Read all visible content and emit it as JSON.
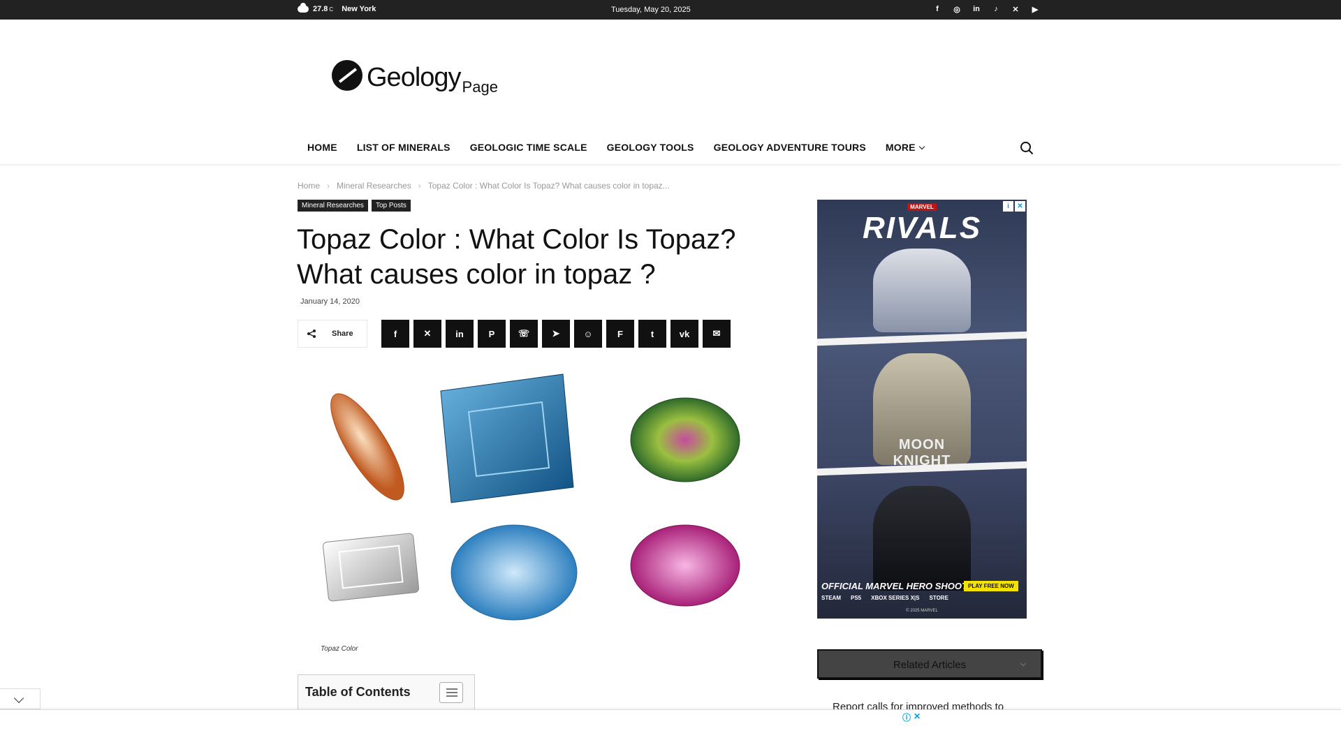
{
  "topbar": {
    "temperature": "27.8",
    "unit": "C",
    "city": "New York",
    "date": "Tuesday, May 20, 2025",
    "socials": [
      "facebook-icon",
      "instagram-icon",
      "linkedin-icon",
      "tiktok-icon",
      "x-icon",
      "youtube-icon"
    ],
    "social_glyphs": [
      "f",
      "◎",
      "in",
      "♪",
      "✕",
      "▶"
    ]
  },
  "logo": {
    "word": "Geology",
    "sub": "Page"
  },
  "nav": {
    "items": [
      "HOME",
      "LIST OF MINERALS",
      "GEOLOGIC TIME SCALE",
      "GEOLOGY TOOLS",
      "GEOLOGY ADVENTURE TOURS",
      "MORE"
    ]
  },
  "breadcrumb": [
    "Home",
    "Mineral Researches",
    "Topaz Color : What Color Is Topaz? What causes color in topaz..."
  ],
  "categories": [
    "Mineral Researches",
    "Top Posts"
  ],
  "article": {
    "title": "Topaz Color : What Color Is Topaz? What causes color in topaz ?",
    "date": "January 14, 2020",
    "image_caption": "Topaz Color"
  },
  "share": {
    "label": "Share",
    "buttons": [
      "facebook",
      "x",
      "linkedin",
      "pinterest",
      "whatsapp",
      "telegram",
      "reddit",
      "flipboard",
      "tumblr",
      "vk",
      "email"
    ],
    "glyphs": [
      "f",
      "✕",
      "in",
      "P",
      "☏",
      "➤",
      "☺",
      "F",
      "t",
      "vk",
      "✉"
    ]
  },
  "toc": {
    "title": "Table of Contents"
  },
  "ad": {
    "marvel": "MARVEL",
    "title": "RIVALS",
    "moon_knight": "MOON KNIGHT",
    "shooter": "OFFICIAL MARVEL HERO SHOOTER",
    "play": "PLAY FREE NOW",
    "platforms": [
      "STEAM",
      "PS5",
      "XBOX SERIES X|S",
      "STORE"
    ],
    "copyright": "© 2025 MARVEL"
  },
  "sidebar": {
    "related_label": "Related Articles",
    "related_first": "Report calls for improved methods to"
  },
  "gems": [
    {
      "name": "imperial-topaz",
      "color": "#e0a070"
    },
    {
      "name": "london-blue-topaz",
      "color": "#2e7fb8"
    },
    {
      "name": "mystic-topaz",
      "color": "#6a9a3a"
    },
    {
      "name": "white-topaz",
      "color": "#d8d8d8"
    },
    {
      "name": "sky-blue-topaz",
      "color": "#5aa6dc"
    },
    {
      "name": "pink-topaz",
      "color": "#d04aa8"
    }
  ]
}
